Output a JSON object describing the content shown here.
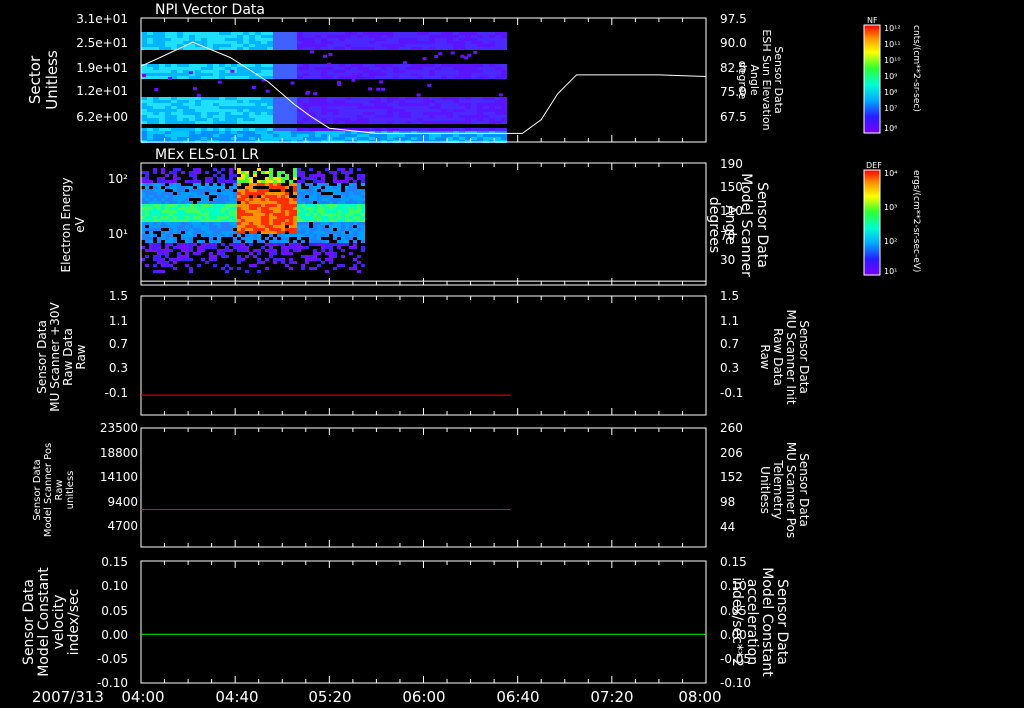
{
  "date": "2007/313",
  "time_labels": [
    "04:00",
    "04:40",
    "05:20",
    "06:00",
    "06:40",
    "07:20",
    "08:00"
  ],
  "colors": {
    "background": "#000000",
    "axis": "#ffffff",
    "red": "#ff0000",
    "green": "#00ff00"
  },
  "panels": [
    {
      "title": "NPI Vector Data",
      "left_label": [
        "Sector",
        "Unitless"
      ],
      "left_ticks": [
        "3.1e+01",
        "2.5e+01",
        "1.9e+01",
        "1.2e+01",
        "6.2e+00"
      ],
      "right_label": [
        "Sensor Data",
        "ESH Sun Elevation",
        "Angle",
        "degree"
      ],
      "right_ticks": [
        "97.5",
        "90.0",
        "82.5",
        "75.0",
        "67.5"
      ],
      "colorbar": {
        "tag": "NF",
        "unit": "cnts/(cm**2-sr-sec)",
        "ticks": [
          "10¹²",
          "10¹¹",
          "10¹⁰",
          "10⁹",
          "10⁸",
          "10⁷",
          "10⁶"
        ]
      }
    },
    {
      "title": "MEx ELS-01 LR",
      "left_label": [
        "Electron Energy",
        "eV"
      ],
      "left_ticks": [
        "10²",
        "10¹"
      ],
      "right_label": [
        "Sensor Data",
        "Model Scanner",
        "Angle",
        "degrees"
      ],
      "right_ticks": [
        "190",
        "150",
        "110",
        "70",
        "30"
      ],
      "colorbar": {
        "tag": "DEF",
        "unit": "ergs/(cm**2-sr-sec-eV)",
        "ticks": [
          "10⁴",
          "10³",
          "10²",
          "10¹"
        ]
      }
    },
    {
      "left_label": [
        "Sensor Data",
        "MU Scanner +30V",
        "Raw Data",
        "Raw"
      ],
      "left_ticks": [
        "1.5",
        "1.1",
        "0.7",
        "0.3",
        "-0.1"
      ],
      "right_label": [
        "Sensor Data",
        "MU Scanner Init",
        "Raw Data",
        "Raw"
      ],
      "right_ticks": [
        "1.5",
        "1.1",
        "0.7",
        "0.3",
        "-0.1"
      ]
    },
    {
      "left_label": [
        "Sensor Data",
        "Model Scanner Pos",
        "Raw",
        "unitless"
      ],
      "left_ticks": [
        "23500",
        "18800",
        "14100",
        "9400",
        "4700"
      ],
      "right_label": [
        "Sensor Data",
        "MU Scanner Pos",
        "Telemetry",
        "Unitless"
      ],
      "right_ticks": [
        "260",
        "206",
        "152",
        "98",
        "44"
      ]
    },
    {
      "left_label": [
        "Sensor Data",
        "Model Constant",
        "velocity",
        "index/sec"
      ],
      "left_ticks": [
        "0.15",
        "0.10",
        "0.05",
        "0.00",
        "-0.05",
        "-0.10"
      ],
      "right_label": [
        "Sensor Data",
        "Model Constant",
        "acceleration",
        "index/sec**2"
      ],
      "right_ticks": [
        "0.15",
        "0.10",
        "0.05",
        "0.00",
        "-0.05",
        "-0.10"
      ]
    }
  ],
  "chart_data": [
    {
      "type": "heatmap",
      "title": "NPI Vector Data",
      "x_range": [
        "04:00",
        "08:00"
      ],
      "ylabel": "Sector Unitless",
      "y2label": "Sensor Data ESH Sun Elevation Angle degree",
      "ylim": [
        0,
        31
      ],
      "y2lim": [
        61.5,
        97.5
      ],
      "data_coverage": [
        "04:00",
        "06:35"
      ],
      "overlay_line": {
        "name": "ESH Sun Elevation Angle",
        "x": [
          "04:00",
          "04:08",
          "04:22",
          "04:38",
          "04:54",
          "05:05",
          "05:12",
          "05:20",
          "05:40",
          "06:00",
          "06:20",
          "06:42",
          "06:50",
          "06:57",
          "07:05",
          "07:20",
          "07:40",
          "08:00"
        ],
        "y": [
          83.5,
          86,
          90.5,
          86,
          79,
          72.5,
          69,
          65.5,
          64,
          64,
          64,
          64,
          68,
          75.5,
          81,
          81,
          81,
          80.5
        ]
      }
    },
    {
      "type": "heatmap",
      "title": "MEx ELS-01 LR",
      "x_range": [
        "04:00",
        "08:00"
      ],
      "ylabel": "Electron Energy eV",
      "y2label": "Sensor Data Model Scanner Angle degrees",
      "yscale": "log",
      "data_coverage": [
        "04:00",
        "05:35"
      ],
      "hotspot": [
        "04:40",
        "05:05"
      ],
      "overlay_line": {
        "name": "Model Scanner Angle",
        "x": [
          "04:00",
          "08:00"
        ],
        "y": [
          16,
          16
        ]
      }
    },
    {
      "type": "line",
      "ylim": [
        -0.3,
        1.5
      ],
      "y2lim": [
        -0.3,
        1.5
      ],
      "series": [
        {
          "name": "MU Scanner +30V Raw Data",
          "x": [
            "04:00",
            "06:37"
          ],
          "y": [
            0,
            0
          ],
          "color": "#ff0000"
        }
      ]
    },
    {
      "type": "line",
      "ylim": [
        0,
        23500
      ],
      "y2lim": [
        0,
        260
      ],
      "series": [
        {
          "name": "Model Scanner Pos",
          "x": [
            "04:00",
            "06:37"
          ],
          "y": [
            7400,
            7400
          ],
          "color": "#ff0000"
        }
      ]
    },
    {
      "type": "line",
      "ylim": [
        -0.1,
        0.15
      ],
      "y2lim": [
        -0.1,
        0.15
      ],
      "series": [
        {
          "name": "Model Constant velocity",
          "x": [
            "04:00",
            "08:00"
          ],
          "y": [
            0,
            0
          ],
          "color": "#00ff00"
        }
      ]
    }
  ]
}
